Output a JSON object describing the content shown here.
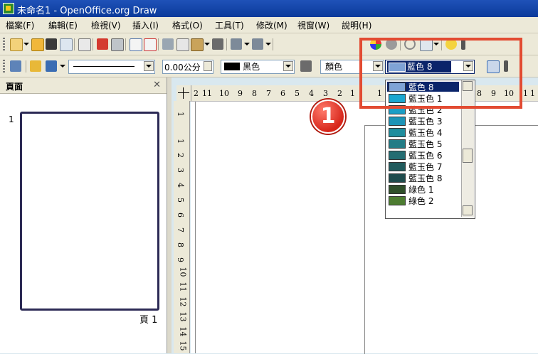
{
  "window": {
    "title": "未命名1 - OpenOffice.org Draw"
  },
  "menu": [
    "檔案(F)",
    "編輯(E)",
    "檢視(V)",
    "插入(I)",
    "格式(O)",
    "工具(T)",
    "修改(M)",
    "視窗(W)",
    "說明(H)"
  ],
  "toolbar2": {
    "line_width": "0.00公分",
    "line_color": "黑色",
    "area_style": "顏色",
    "area_color": "藍色 8"
  },
  "pages_panel": {
    "title": "頁面",
    "page_number": "1",
    "page_label": "頁 1"
  },
  "ruler": {
    "h_ticks": [
      "2",
      "11",
      "10",
      "9",
      "8",
      "7",
      "6",
      "5",
      "4",
      "3",
      "2",
      "1",
      "1",
      "8",
      "9",
      "10",
      "1",
      "1"
    ],
    "v_ticks": [
      "1",
      "2",
      "3",
      "4",
      "5",
      "6",
      "7",
      "8",
      "9",
      "10",
      "11",
      "12",
      "13",
      "14",
      "15"
    ]
  },
  "color_list": [
    {
      "label": "藍色 8",
      "color": "#7fa3d6",
      "selected": true
    },
    {
      "label": "藍玉色 1",
      "color": "#1aa7d0",
      "selected": false
    },
    {
      "label": "藍玉色 2",
      "color": "#1b9ec6",
      "selected": false
    },
    {
      "label": "藍玉色 3",
      "color": "#1c93b6",
      "selected": false
    },
    {
      "label": "藍玉色 4",
      "color": "#1f8d9d",
      "selected": false
    },
    {
      "label": "藍玉色 5",
      "color": "#237c86",
      "selected": false
    },
    {
      "label": "藍玉色 6",
      "color": "#246d72",
      "selected": false
    },
    {
      "label": "藍玉色 7",
      "color": "#215b5d",
      "selected": false
    },
    {
      "label": "藍玉色 8",
      "color": "#1e4b4c",
      "selected": false
    },
    {
      "label": "綠色 1",
      "color": "#2f4f2a",
      "selected": false
    },
    {
      "label": "綠色 2",
      "color": "#4d7c31",
      "selected": false
    }
  ],
  "annotation": {
    "step": "1",
    "color": "#e24b32"
  }
}
